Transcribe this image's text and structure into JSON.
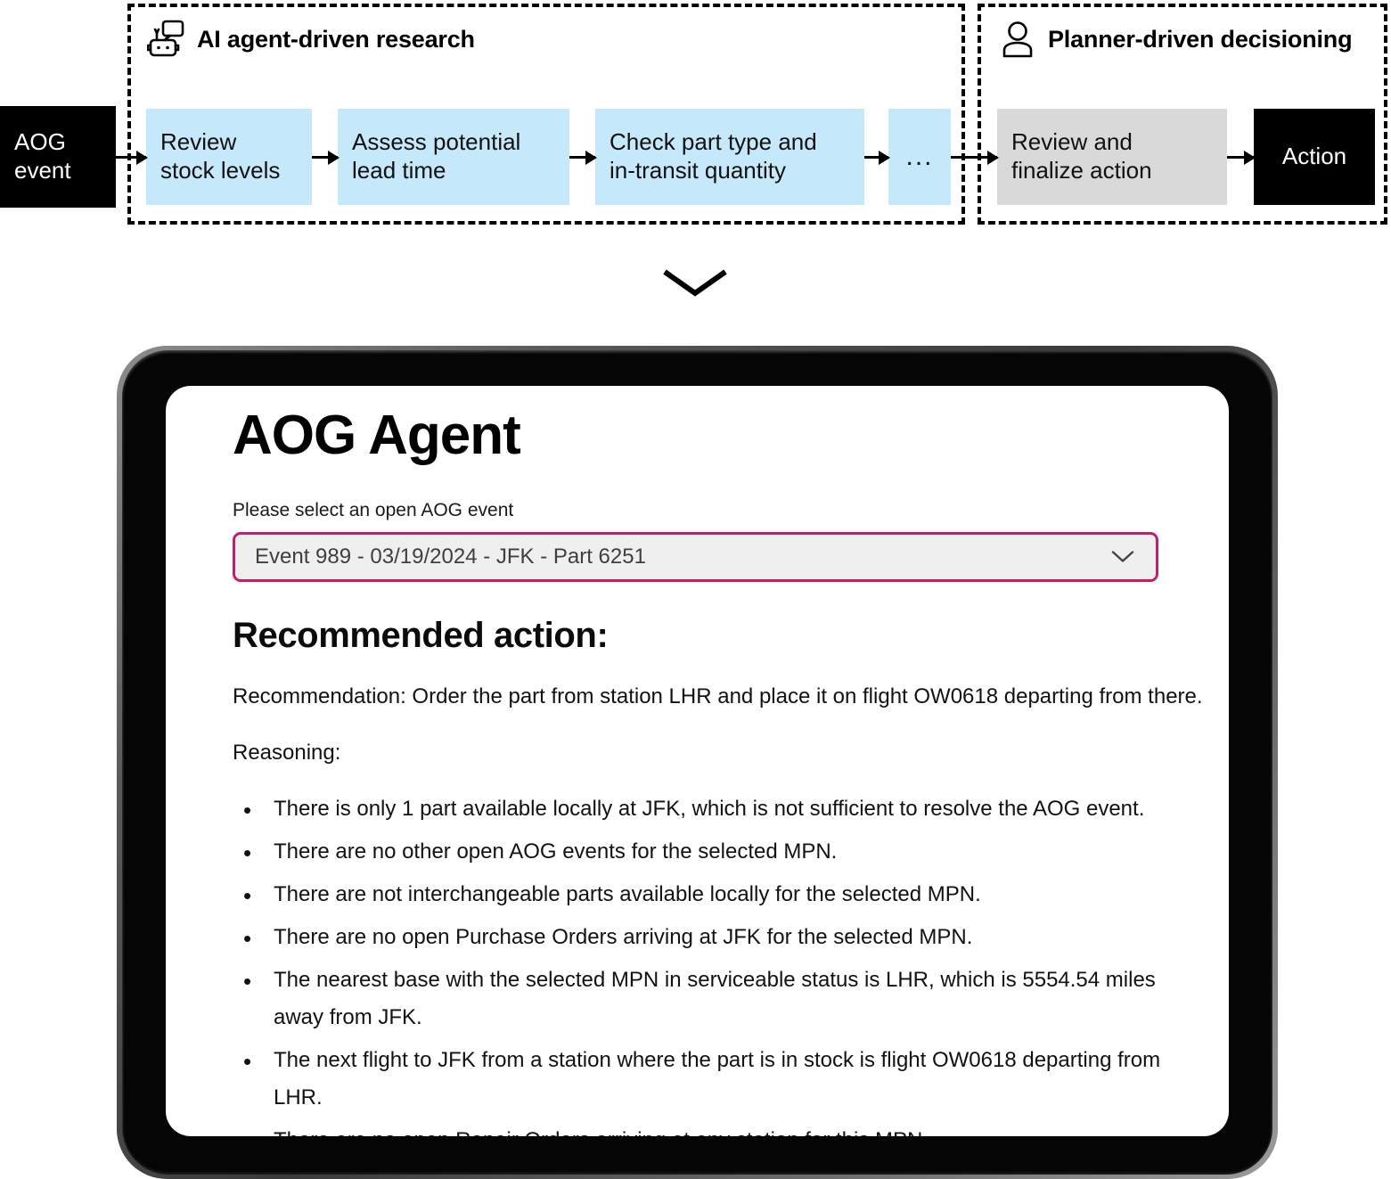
{
  "flow": {
    "groups": [
      {
        "title": "AI agent-driven research",
        "icon": "robot-icon"
      },
      {
        "title": "Planner-driven decisioning",
        "icon": "person-icon"
      }
    ],
    "nodes": {
      "start": "AOG\nevent",
      "start_line1": "AOG",
      "start_line2": "event",
      "step1": "Review\nstock levels",
      "step1_line1": "Review",
      "step1_line2": "stock levels",
      "step2": "Assess potential\nlead time",
      "step2_line1": "Assess potential",
      "step2_line2": "lead time",
      "step3": "Check part type and\nin-transit quantity",
      "step3_line1": "Check part type and",
      "step3_line2": "in-transit quantity",
      "more": "...",
      "step4": "Review and\nfinalize action",
      "step4_line1": "Review and",
      "step4_line2": "finalize action",
      "end": "Action"
    },
    "colors": {
      "agent_step": "#c5e8fa",
      "planner_step": "#d9d9d9",
      "terminal": "#000000"
    }
  },
  "app": {
    "title": "AOG Agent",
    "select_label": "Please select an open AOG event",
    "selected_event": "Event 989 - 03/19/2024 - JFK - Part 6251",
    "select_chevron": "chevron-down-icon",
    "accent_color": "#c41e6a",
    "recommendation_heading": "Recommended action:",
    "recommendation": "Recommendation: Order the part from station LHR and place it on flight OW0618 departing from there.",
    "reasoning_label": "Reasoning:",
    "reasons": [
      "There is only 1 part available locally at JFK, which is not sufficient to resolve the AOG event.",
      "There are no other open AOG events for the selected MPN.",
      "There are not interchangeable parts available locally for the selected MPN.",
      "There are no open Purchase Orders arriving at JFK for the selected MPN.",
      "The nearest base with the selected MPN in serviceable status is LHR, which is 5554.54 miles away from JFK.",
      "The next flight to JFK from a station where the part is in stock is flight OW0618 departing from LHR.",
      "There are no open Repair Orders arriving at any station for this MPN."
    ]
  }
}
